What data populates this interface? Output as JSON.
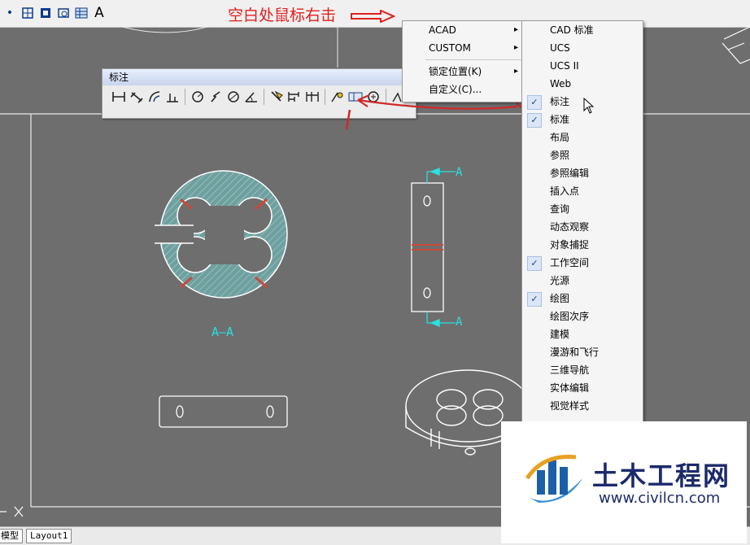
{
  "annotation": {
    "text": "空白处鼠标右击"
  },
  "toolbar_top": {
    "text_tool": "A"
  },
  "dim_toolbar": {
    "title": "标注"
  },
  "menu_primary": {
    "items": [
      {
        "label": "ACAD",
        "arrow": "▸"
      },
      {
        "label": "CUSTOM",
        "arrow": "▸"
      },
      {
        "label": "锁定位置(K)",
        "arrow": "▸"
      },
      {
        "label": "自定义(C)..."
      }
    ]
  },
  "menu_toolbars": {
    "check": "✓",
    "items": [
      {
        "label": "CAD 标准",
        "checked": false
      },
      {
        "label": "UCS",
        "checked": false
      },
      {
        "label": "UCS II",
        "checked": false
      },
      {
        "label": "Web",
        "checked": false
      },
      {
        "label": "标注",
        "checked": true
      },
      {
        "label": "标准",
        "checked": true
      },
      {
        "label": "布局",
        "checked": false
      },
      {
        "label": "参照",
        "checked": false
      },
      {
        "label": "参照编辑",
        "checked": false
      },
      {
        "label": "插入点",
        "checked": false
      },
      {
        "label": "查询",
        "checked": false
      },
      {
        "label": "动态观察",
        "checked": false
      },
      {
        "label": "对象捕捉",
        "checked": false
      },
      {
        "label": "工作空间",
        "checked": true
      },
      {
        "label": "光源",
        "checked": false
      },
      {
        "label": "绘图",
        "checked": true
      },
      {
        "label": "绘图次序",
        "checked": false
      },
      {
        "label": "建模",
        "checked": false
      },
      {
        "label": "漫游和飞行",
        "checked": false
      },
      {
        "label": "三维导航",
        "checked": false
      },
      {
        "label": "实体编辑",
        "checked": false
      },
      {
        "label": "视觉样式",
        "checked": false
      }
    ]
  },
  "drawing": {
    "section_label": "A—A",
    "cut_label": "A"
  },
  "tabs": {
    "model": "模型",
    "layout1": "Layout1"
  },
  "watermark": {
    "title": "土木工程网",
    "url": "www.civilcn.com"
  },
  "colors": {
    "annotation": "#e02020",
    "cyan": "#2be0e0",
    "hatch": "#6fa0a0",
    "background": "#6e6e6e"
  }
}
